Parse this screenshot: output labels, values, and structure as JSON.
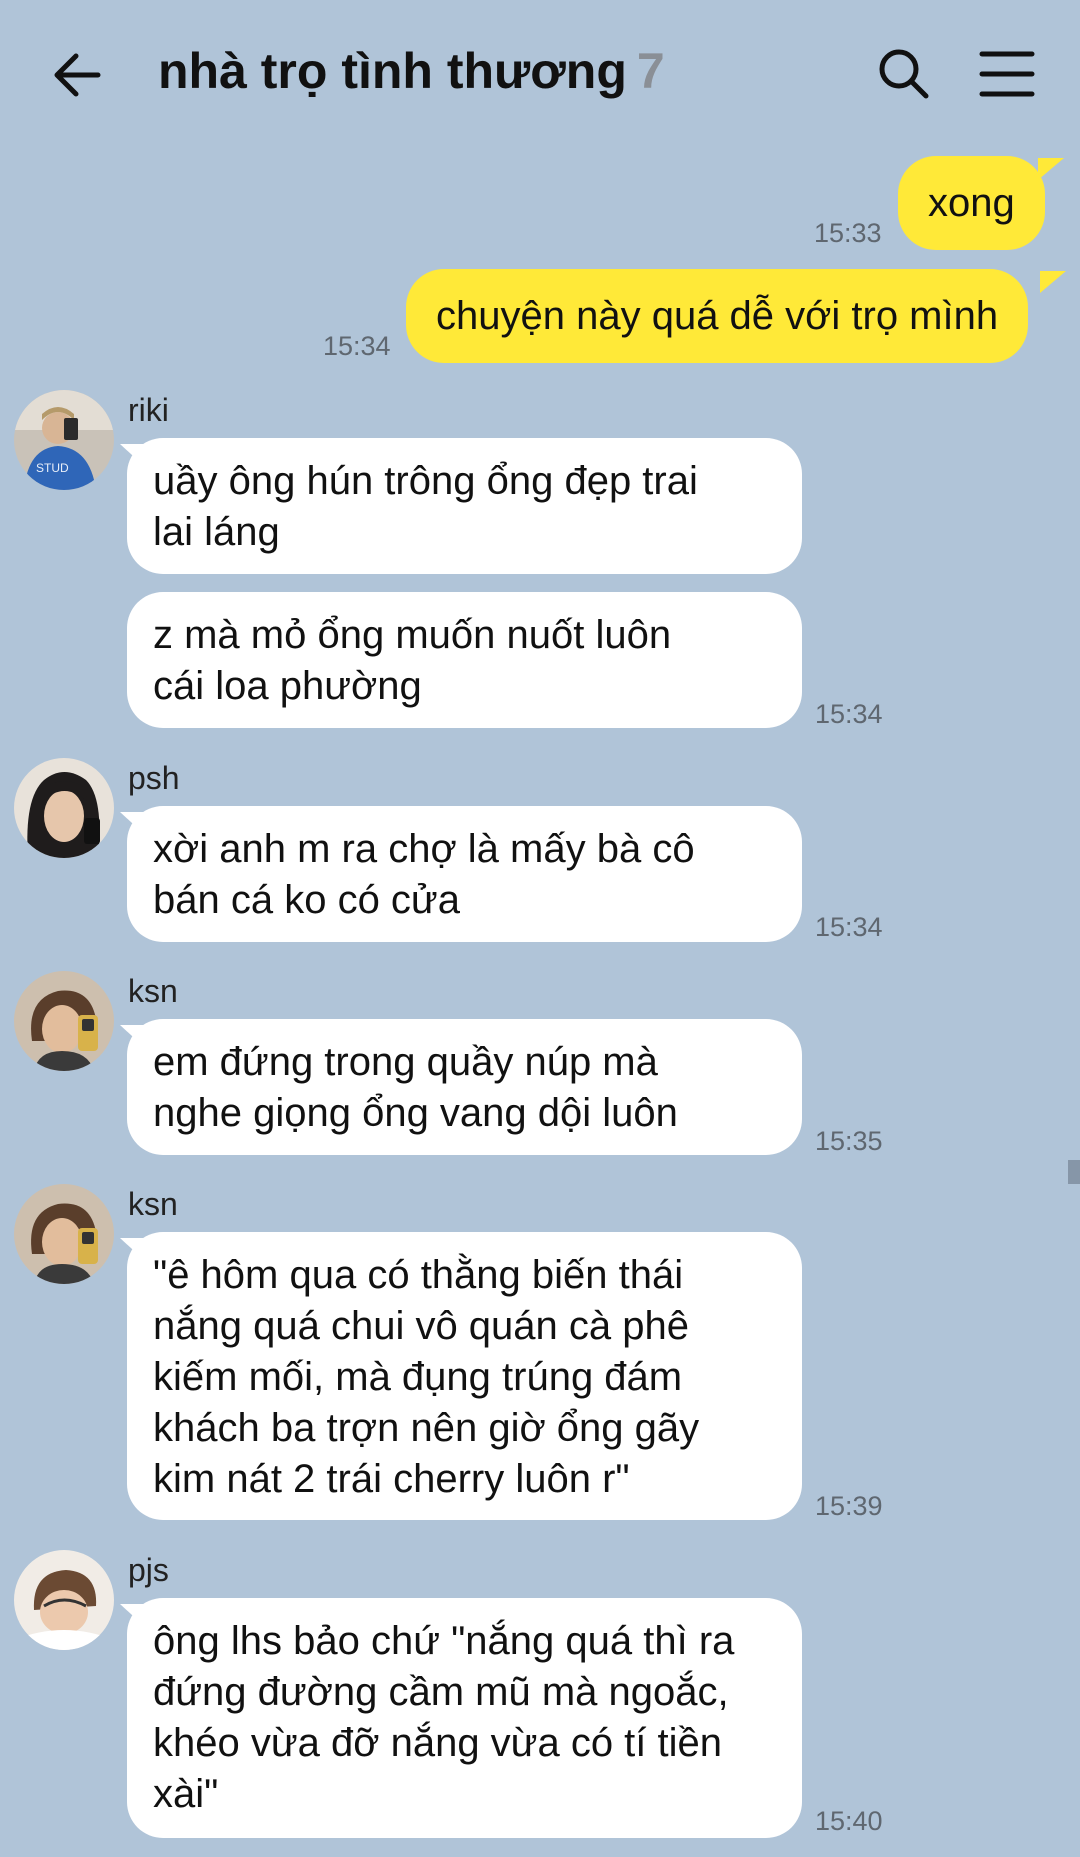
{
  "header": {
    "title": "nhà trọ tình thương",
    "member_count": "7"
  },
  "messages_mine": [
    {
      "text": "xong",
      "time": "15:33"
    },
    {
      "text": "chuyện này quá dễ với trọ mình",
      "time": "15:34"
    }
  ],
  "groups": [
    {
      "sender": "riki",
      "bubbles": [
        {
          "lines": [
            "uầy ông hún trông ổng đẹp trai",
            "lai láng"
          ]
        },
        {
          "lines": [
            "z mà mỏ ổng muốn nuốt luôn",
            "cái loa phường"
          ],
          "time": "15:34"
        }
      ]
    },
    {
      "sender": "psh",
      "bubbles": [
        {
          "lines": [
            "xời anh m ra chợ là mấy bà cô",
            "bán cá ko có cửa"
          ],
          "time": "15:34"
        }
      ]
    },
    {
      "sender": "ksn",
      "bubbles": [
        {
          "lines": [
            "em đứng trong quầy núp mà",
            "nghe giọng ổng vang dội luôn"
          ],
          "time": "15:35"
        }
      ]
    },
    {
      "sender": "ksn",
      "bubbles": [
        {
          "lines": [
            "\"ê hôm qua có thằng biến thái",
            "nắng quá chui vô quán cà phê",
            "kiếm mối, mà đụng trúng đám",
            "khách ba trợn nên giờ ổng gãy",
            "kim nát 2 trái cherry luôn r\""
          ],
          "time": "15:39"
        }
      ]
    },
    {
      "sender": "pjs",
      "bubbles": [
        {
          "lines": [
            "ông lhs bảo chứ \"nắng quá thì ra",
            "đứng đường cầm mũ mà ngoắc,",
            "khéo vừa đỡ nắng vừa có tí tiền",
            "xài\""
          ],
          "time": "15:40"
        }
      ]
    }
  ]
}
